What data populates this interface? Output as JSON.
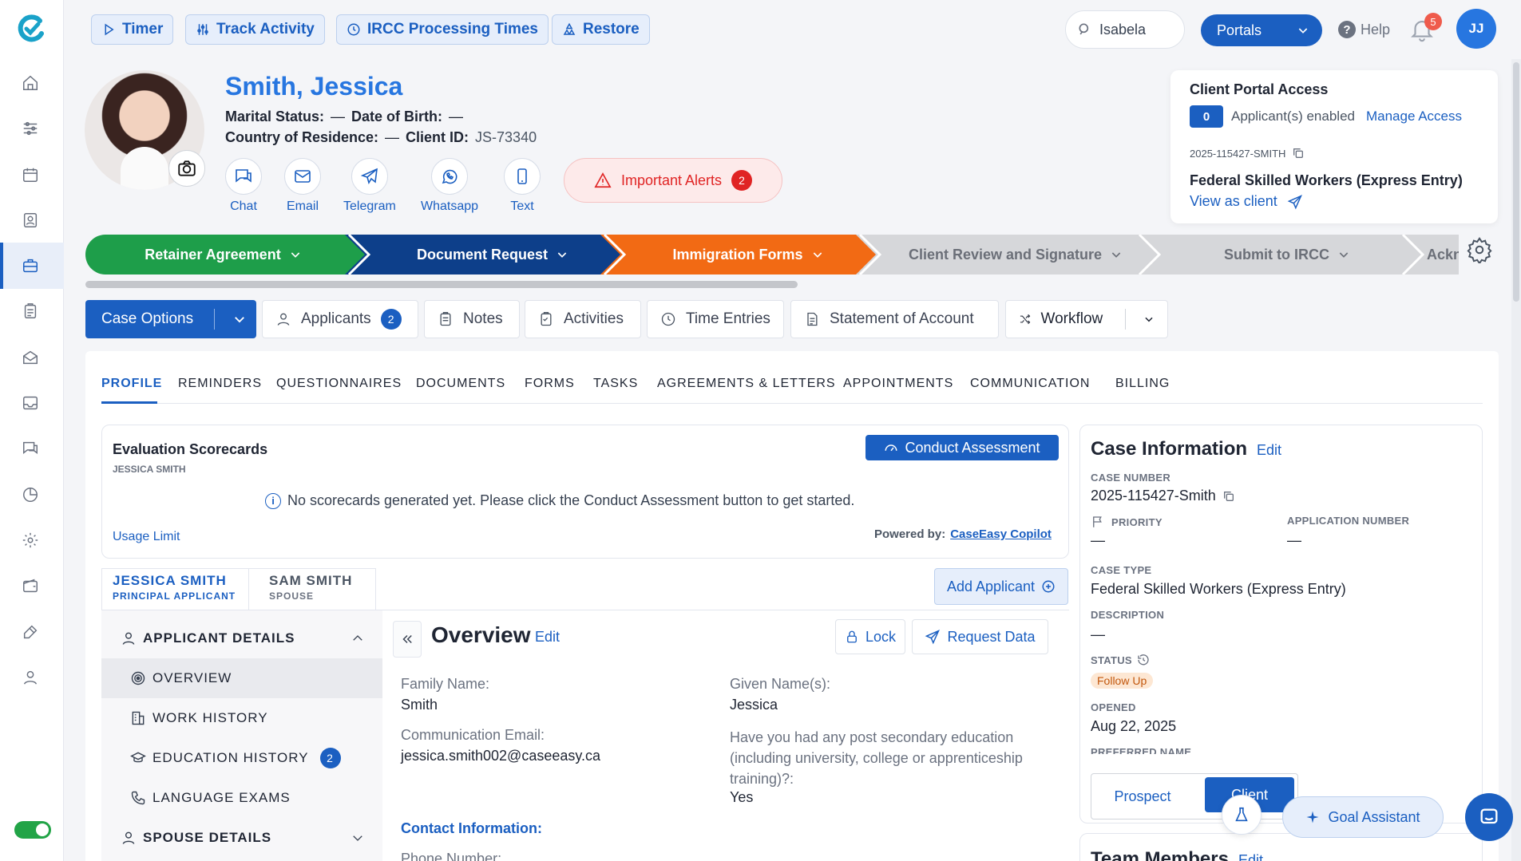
{
  "topbar": {
    "timer": "Timer",
    "track_activity": "Track Activity",
    "ircc_times": "IRCC Processing Times",
    "restore": "Restore",
    "search_value": "Isabela",
    "portals": "Portals",
    "help": "Help",
    "notif_count": "5",
    "avatar": "JJ"
  },
  "client": {
    "name": "Smith, Jessica",
    "marital_label": "Marital Status:",
    "marital_value": "—",
    "dob_label": "Date of Birth:",
    "dob_value": "—",
    "country_label": "Country of Residence:",
    "country_value": "—",
    "client_id_label": "Client ID:",
    "client_id_value": "JS-73340"
  },
  "contacts": [
    "Chat",
    "Email",
    "Telegram",
    "Whatsapp",
    "Text"
  ],
  "alerts": {
    "label": "Important Alerts",
    "count": "2"
  },
  "portal_card": {
    "title": "Client Portal Access",
    "count": "0",
    "enabled_text": "Applicant(s) enabled",
    "manage": "Manage Access",
    "case_ref": "2025-115427-SMITH",
    "program": "Federal Skilled Workers (Express Entry)",
    "view_as_client": "View as client"
  },
  "stages": [
    {
      "label": "Retainer Agreement",
      "color": "#1e9e4a"
    },
    {
      "label": "Document Request",
      "color": "#0d3f8a"
    },
    {
      "label": "Immigration Forms",
      "color": "#f26a14"
    },
    {
      "label": "Client Review and Signature",
      "color": "#d6d7da"
    },
    {
      "label": "Submit to IRCC",
      "color": "#d6d7da"
    },
    {
      "label": "Ackn",
      "color": "#d6d7da"
    }
  ],
  "case_options": {
    "case_options": "Case Options",
    "applicants": "Applicants",
    "applicants_count": "2",
    "notes": "Notes",
    "activities": "Activities",
    "time_entries": "Time Entries",
    "statement": "Statement of Account",
    "workflow": "Workflow"
  },
  "tabs": [
    "PROFILE",
    "REMINDERS",
    "QUESTIONNAIRES",
    "DOCUMENTS",
    "FORMS",
    "TASKS",
    "AGREEMENTS & LETTERS",
    "APPOINTMENTS",
    "COMMUNICATION",
    "BILLING"
  ],
  "scorecard": {
    "title": "Evaluation Scorecards",
    "subtitle": "JESSICA SMITH",
    "conduct": "Conduct Assessment",
    "empty": "No scorecards generated yet. Please click the Conduct Assessment button to get started.",
    "usage": "Usage Limit",
    "powered": "Powered by:",
    "powered_link": "CaseEasy Copilot"
  },
  "applicant_tabs": {
    "a1_name": "JESSICA SMITH",
    "a1_role": "PRINCIPAL APPLICANT",
    "a2_name": "SAM SMITH",
    "a2_role": "SPOUSE",
    "add": "Add Applicant"
  },
  "sidenav": {
    "applicant_details": "APPLICANT DETAILS",
    "overview": "OVERVIEW",
    "work_history": "WORK HISTORY",
    "education_history": "EDUCATION HISTORY",
    "education_count": "2",
    "language_exams": "LANGUAGE EXAMS",
    "spouse_details": "SPOUSE DETAILS"
  },
  "overview": {
    "title": "Overview",
    "edit": "Edit",
    "lock": "Lock",
    "request_data": "Request Data",
    "family_name_label": "Family Name:",
    "family_name": "Smith",
    "given_name_label": "Given Name(s):",
    "given_name": "Jessica",
    "email_label": "Communication Email:",
    "email": "jessica.smith002@caseeasy.ca",
    "education_q": "Have you had any post secondary education (including university, college or apprenticeship training)?:",
    "education_a": "Yes",
    "contact_info": "Contact Information:",
    "phone_label": "Phone Number:"
  },
  "case_info": {
    "title": "Case Information",
    "edit": "Edit",
    "case_number_label": "CASE NUMBER",
    "case_number": "2025-115427-Smith",
    "priority_label": "PRIORITY",
    "priority": "—",
    "app_number_label": "APPLICATION NUMBER",
    "app_number": "—",
    "case_type_label": "CASE TYPE",
    "case_type": "Federal Skilled Workers (Express Entry)",
    "description_label": "DESCRIPTION",
    "description": "—",
    "status_label": "STATUS",
    "status": "Follow Up",
    "opened_label": "OPENED",
    "opened": "Aug 22, 2025",
    "preferred_label": "PREFERRED NAME",
    "prospect": "Prospect",
    "client": "Client",
    "team_members": "Team Members",
    "team_edit": "Edit"
  },
  "goal_assistant": "Goal Assistant"
}
